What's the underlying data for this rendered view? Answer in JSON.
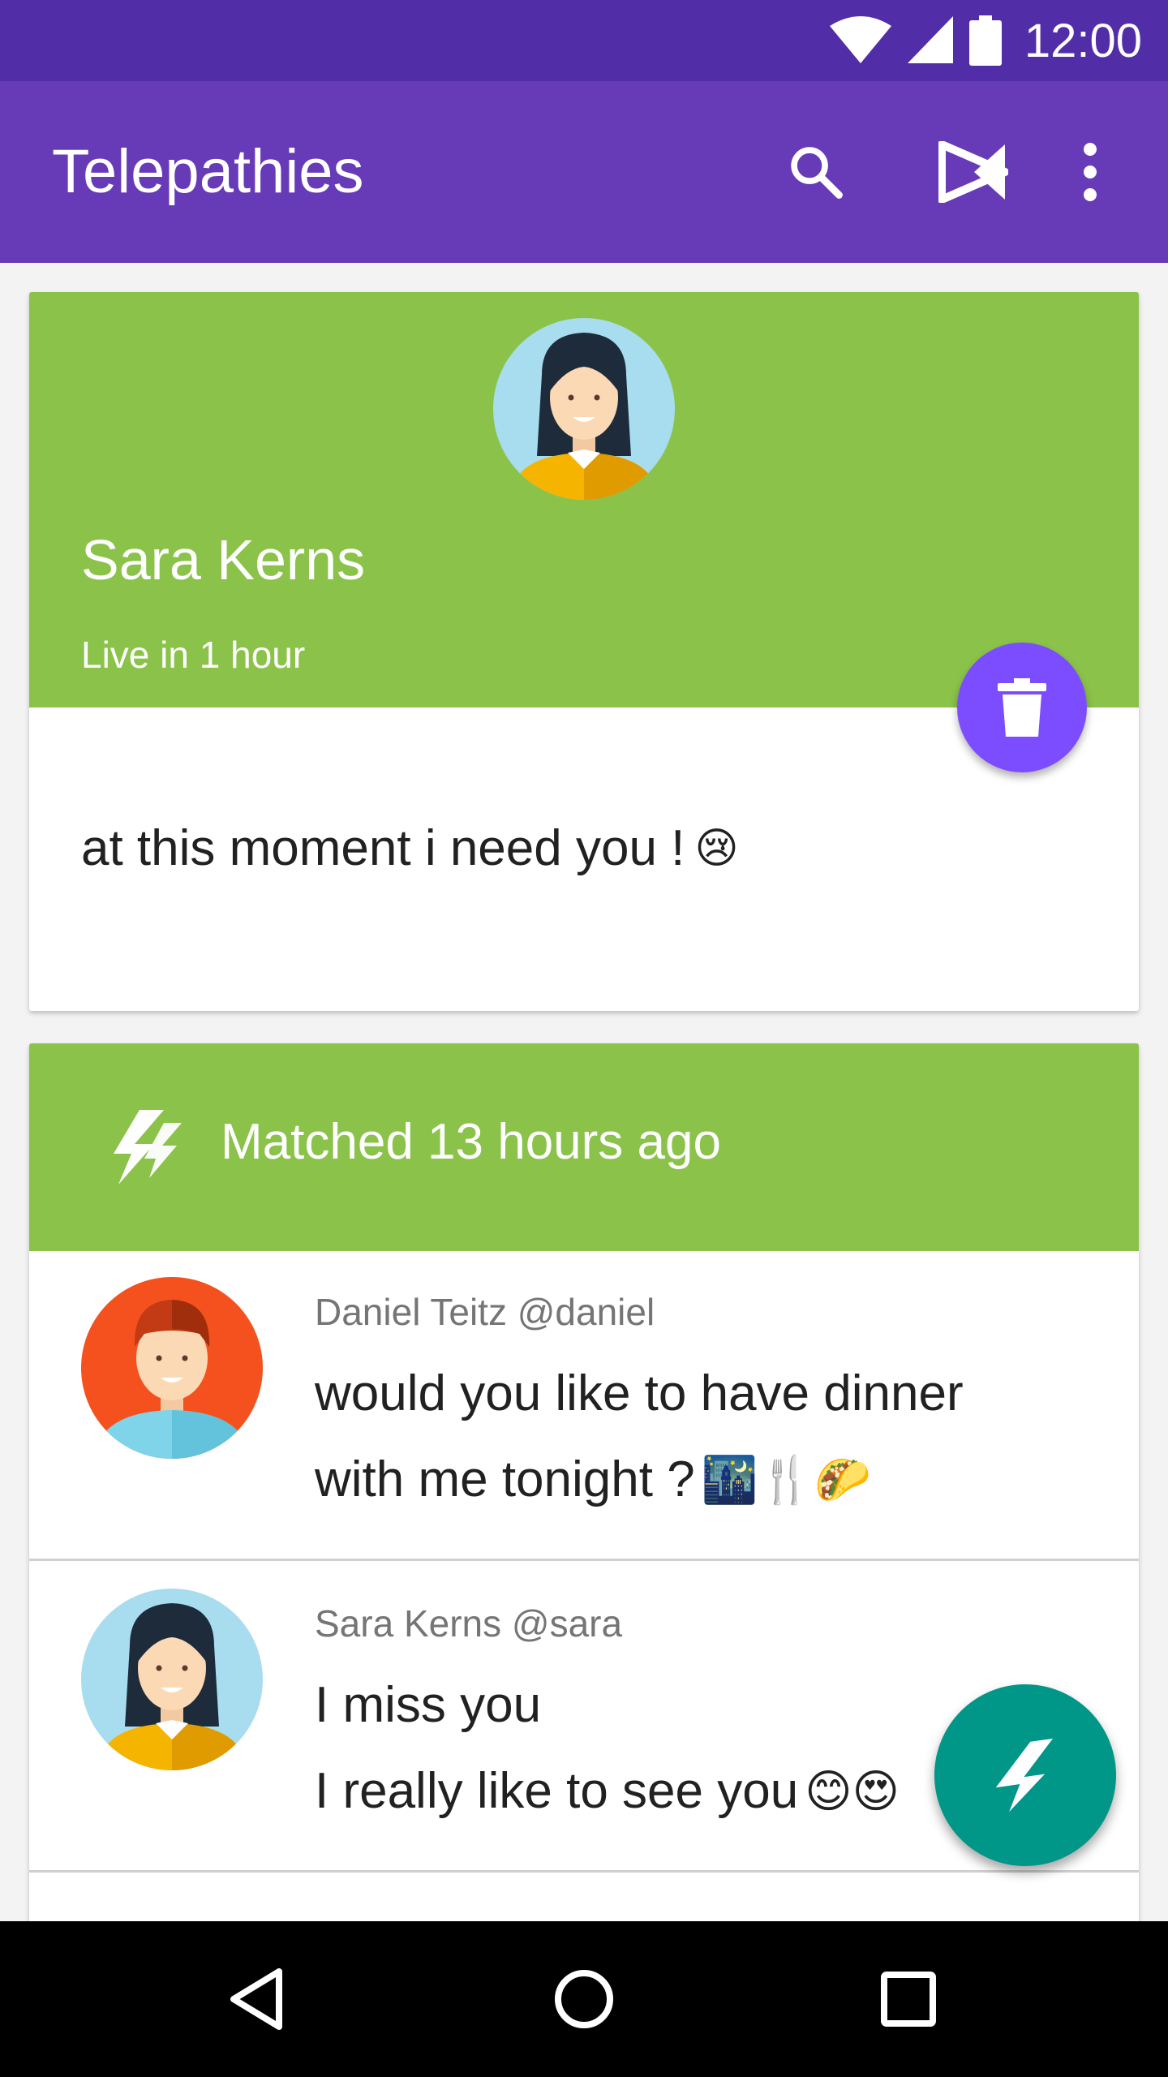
{
  "status_bar": {
    "time": "12:00",
    "icons": [
      "wifi-icon",
      "signal-icon",
      "battery-icon"
    ]
  },
  "app_bar": {
    "title": "Telepathies",
    "actions": [
      "search-icon",
      "telepathy-logo-icon",
      "more-vert-icon"
    ]
  },
  "live_card": {
    "name": "Sara Kerns",
    "subtitle": "Live in 1 hour",
    "message": "at this moment i need you !",
    "message_emoji": "😢"
  },
  "match_card": {
    "header": "Matched 13 hours ago",
    "messages": [
      {
        "author": "Daniel Teitz @daniel",
        "line1": "would you like to have dinner",
        "line2": "with me tonight ?",
        "emojis": "🌃🍴🌮"
      },
      {
        "author": "Sara Kerns @sara",
        "line1": "I miss you",
        "line2": "I really like to see you",
        "emojis": "😊😍"
      }
    ]
  },
  "colors": {
    "status_bar": "#512da8",
    "app_bar": "#673ab7",
    "card_header": "#8bc34a",
    "trash_fab": "#7c4dff",
    "send_fab": "#009688"
  }
}
